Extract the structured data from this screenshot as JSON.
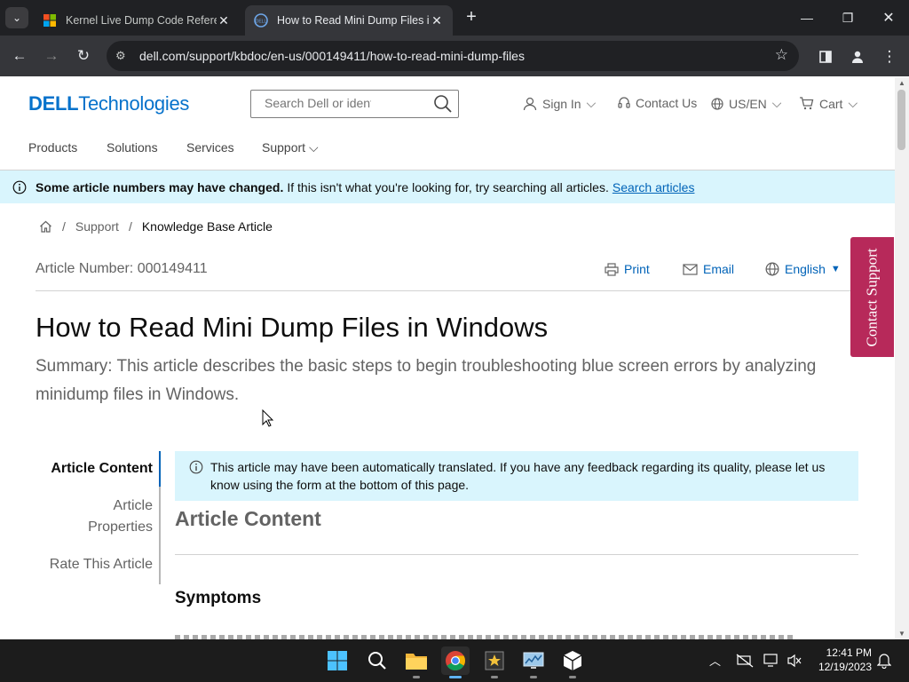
{
  "browser": {
    "tabs": [
      {
        "title": "Kernel Live Dump Code Reference",
        "active": false
      },
      {
        "title": "How to Read Mini Dump Files in Windows",
        "active": true
      }
    ],
    "url": "dell.com/support/kbdoc/en-us/000149411/how-to-read-mini-dump-files"
  },
  "header": {
    "logo_dell": "DELL",
    "logo_tech": "Technologies",
    "search_placeholder": "Search Dell or identify",
    "sign_in": "Sign In",
    "contact_us": "Contact Us",
    "locale": "US/EN",
    "cart": "Cart",
    "nav": [
      "Products",
      "Solutions",
      "Services",
      "Support"
    ]
  },
  "banner": {
    "bold": "Some article numbers may have changed.",
    "text": "If this isn't what you're looking for, try searching all articles.",
    "link": "Search articles"
  },
  "breadcrumb": {
    "support": "Support",
    "current": "Knowledge Base Article",
    "sep": "/"
  },
  "article": {
    "number": "Article Number: 000149411",
    "print": "Print",
    "email": "Email",
    "language": "English",
    "title": "How to Read Mini Dump Files in Windows",
    "summary": "Summary: This article describes the basic steps to begin troubleshooting blue screen errors by analyzing minidump files in Windows.",
    "toc": {
      "content": "Article Content",
      "properties_line1": "Article",
      "properties_line2": "Properties",
      "rate": "Rate This Article"
    },
    "translation_note": "This article may have been automatically translated. If you have any feedback regarding its quality, please let us know using the form at the bottom of this page.",
    "section_heading": "Article Content",
    "symptoms": "Symptoms"
  },
  "contact_support": "Contact Support",
  "taskbar": {
    "time": "12:41 PM",
    "date": "12/19/2023"
  },
  "colors": {
    "dell_blue": "#0672cb",
    "link_blue": "#0063b8",
    "banner_bg": "#d9f5fd",
    "contact_tab": "#b7295a"
  }
}
